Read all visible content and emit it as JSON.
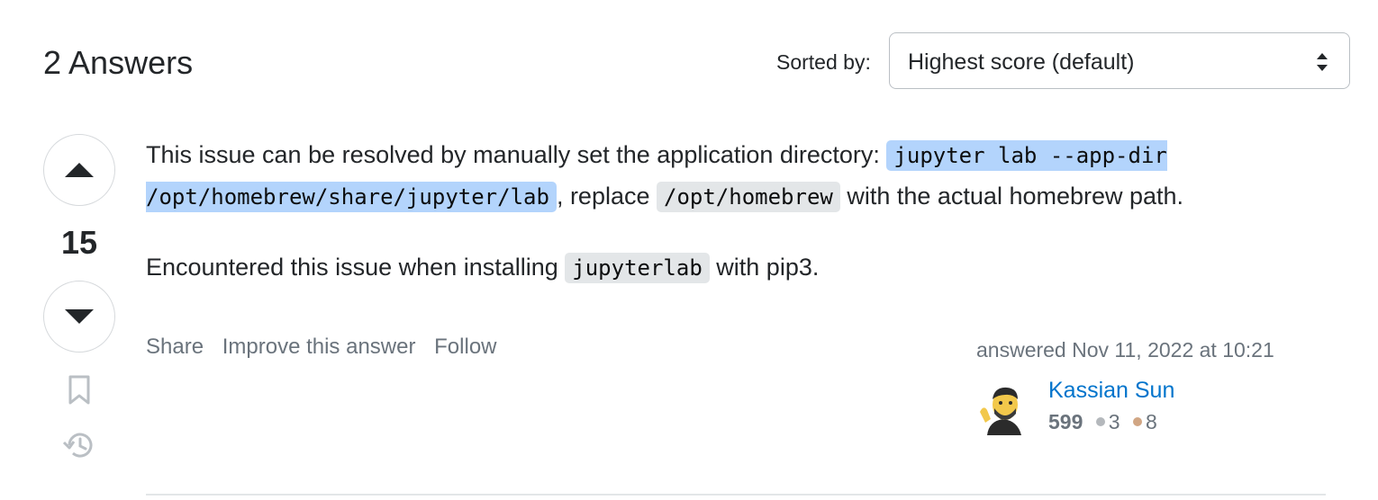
{
  "header": {
    "answers_count": "2 Answers",
    "sort_label": "Sorted by:",
    "sort_value": "Highest score (default)"
  },
  "vote": {
    "score": "15"
  },
  "answer": {
    "p1_text_1": "This issue can be resolved by manually set the application directory: ",
    "p1_code_1": "jupyter lab --app-dir /opt/homebrew/share/jupyter/lab",
    "p1_text_2": ", replace ",
    "p1_code_2": "/opt/homebrew",
    "p1_text_3": " with the actual homebrew path.",
    "p2_text_1": "Encountered this issue when installing ",
    "p2_code_1": "jupyterlab",
    "p2_text_2": " with pip3."
  },
  "post_menu": {
    "share": "Share",
    "improve": "Improve this answer",
    "follow": "Follow"
  },
  "user_card": {
    "action": "answered Nov 11, 2022 at 10:21",
    "name": "Kassian Sun",
    "reputation": "599",
    "silver": "3",
    "bronze": "8"
  },
  "colors": {
    "link": "#0074cc",
    "silver": "#b4b8bc",
    "bronze": "#d1a684",
    "selection": "#b3d4fc"
  },
  "icons": [
    "vote-up-icon",
    "vote-down-icon",
    "bookmark-icon",
    "history-icon",
    "sort-arrows-icon"
  ]
}
